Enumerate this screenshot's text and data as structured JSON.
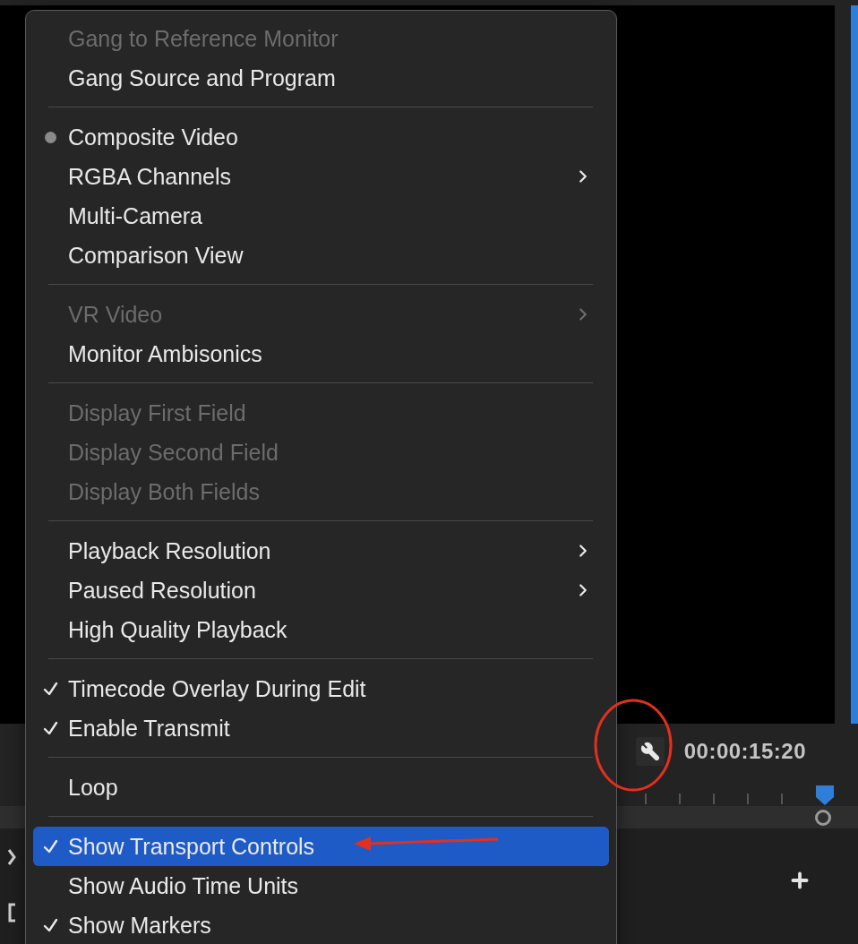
{
  "monitor": {
    "timecode": "00:00:15:20"
  },
  "menu": {
    "groups": [
      {
        "items": [
          {
            "label": "Gang to Reference Monitor",
            "kind": "check",
            "checked": false,
            "disabled": true,
            "submenu": false,
            "selected": false
          },
          {
            "label": "Gang Source and Program",
            "kind": "check",
            "checked": false,
            "disabled": false,
            "submenu": false,
            "selected": false
          }
        ]
      },
      {
        "items": [
          {
            "label": "Composite Video",
            "kind": "radio",
            "checked": true,
            "disabled": false,
            "submenu": false,
            "selected": false
          },
          {
            "label": "RGBA Channels",
            "kind": "radio",
            "checked": false,
            "disabled": false,
            "submenu": true,
            "selected": false
          },
          {
            "label": "Multi-Camera",
            "kind": "radio",
            "checked": false,
            "disabled": false,
            "submenu": false,
            "selected": false
          },
          {
            "label": "Comparison View",
            "kind": "radio",
            "checked": false,
            "disabled": false,
            "submenu": false,
            "selected": false
          }
        ]
      },
      {
        "items": [
          {
            "label": "VR Video",
            "kind": "check",
            "checked": false,
            "disabled": true,
            "submenu": true,
            "selected": false
          },
          {
            "label": "Monitor Ambisonics",
            "kind": "check",
            "checked": false,
            "disabled": false,
            "submenu": false,
            "selected": false
          }
        ]
      },
      {
        "items": [
          {
            "label": "Display First Field",
            "kind": "check",
            "checked": false,
            "disabled": true,
            "submenu": false,
            "selected": false
          },
          {
            "label": "Display Second Field",
            "kind": "check",
            "checked": false,
            "disabled": true,
            "submenu": false,
            "selected": false
          },
          {
            "label": "Display Both Fields",
            "kind": "check",
            "checked": false,
            "disabled": true,
            "submenu": false,
            "selected": false
          }
        ]
      },
      {
        "items": [
          {
            "label": "Playback Resolution",
            "kind": "check",
            "checked": false,
            "disabled": false,
            "submenu": true,
            "selected": false
          },
          {
            "label": "Paused Resolution",
            "kind": "check",
            "checked": false,
            "disabled": false,
            "submenu": true,
            "selected": false
          },
          {
            "label": "High Quality Playback",
            "kind": "check",
            "checked": false,
            "disabled": false,
            "submenu": false,
            "selected": false
          }
        ]
      },
      {
        "items": [
          {
            "label": "Timecode Overlay During Edit",
            "kind": "check",
            "checked": true,
            "disabled": false,
            "submenu": false,
            "selected": false
          },
          {
            "label": "Enable Transmit",
            "kind": "check",
            "checked": true,
            "disabled": false,
            "submenu": false,
            "selected": false
          }
        ]
      },
      {
        "items": [
          {
            "label": "Loop",
            "kind": "check",
            "checked": false,
            "disabled": false,
            "submenu": false,
            "selected": false
          }
        ]
      },
      {
        "items": [
          {
            "label": "Show Transport Controls",
            "kind": "check",
            "checked": true,
            "disabled": false,
            "submenu": false,
            "selected": true
          },
          {
            "label": "Show Audio Time Units",
            "kind": "check",
            "checked": false,
            "disabled": false,
            "submenu": false,
            "selected": false
          },
          {
            "label": "Show Markers",
            "kind": "check",
            "checked": true,
            "disabled": false,
            "submenu": false,
            "selected": false
          }
        ]
      }
    ]
  }
}
